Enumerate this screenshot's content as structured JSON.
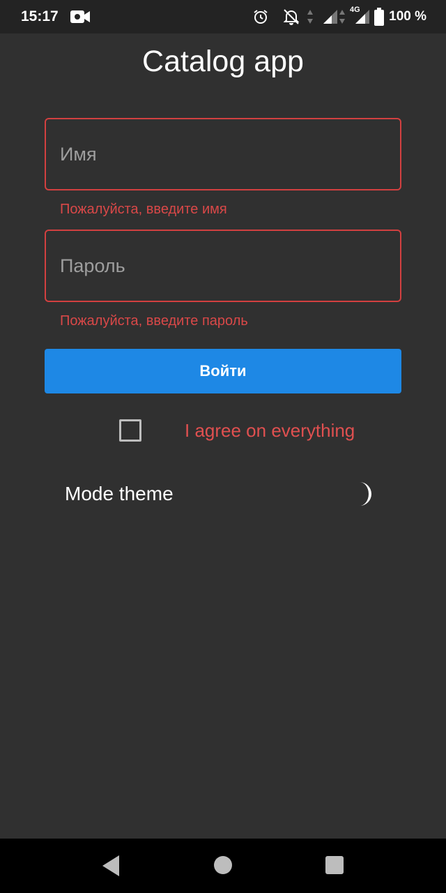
{
  "status_bar": {
    "time": "15:17",
    "network": "4G",
    "battery": "100 %"
  },
  "app": {
    "title": "Catalog app"
  },
  "form": {
    "name_placeholder": "Имя",
    "name_error": "Пожалуйста, введите имя",
    "password_placeholder": "Пароль",
    "password_error": "Пожалуйста, введите пароль",
    "login_label": "Войти",
    "agree_label": "I agree on everything",
    "agree_checked": false
  },
  "theme": {
    "label": "Mode theme",
    "icon": "moon-icon"
  },
  "colors": {
    "background": "#303030",
    "error": "#d94848",
    "accent": "#1e88e5"
  }
}
